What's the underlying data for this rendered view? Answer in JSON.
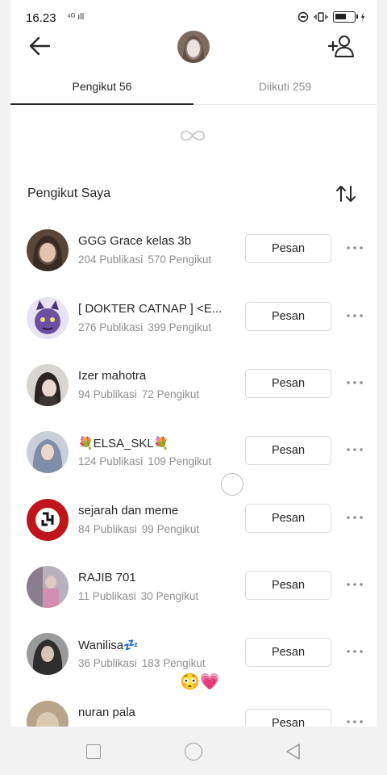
{
  "status_bar": {
    "time": "16.23",
    "signal": "⁴ᴳ ıll",
    "battery_level": 0.6
  },
  "header": {
    "back_icon": "arrow-left-icon",
    "avatar_icon": "profile-avatar",
    "add_icon": "add-person-icon"
  },
  "tabs": [
    {
      "label": "Pengikut 56",
      "active": true
    },
    {
      "label": "Diikuti 259",
      "active": false
    }
  ],
  "section": {
    "title": "Pengikut Saya",
    "sort_icon": "sort-arrows-icon"
  },
  "followers": [
    {
      "name": "GGG Grace kelas 3b",
      "posts": "204 Publikasi",
      "followers": "570 Pengikut",
      "button": "Pesan",
      "avatar_color": "#5a4636"
    },
    {
      "name": "[ DOKTER CATNAP ] <E...",
      "posts": "276 Publikasi",
      "followers": "399 Pengikut",
      "button": "Pesan",
      "avatar_color": "#6b4fa3"
    },
    {
      "name": "Izer mahotra",
      "posts": "94 Publikasi",
      "followers": "72 Pengikut",
      "button": "Pesan",
      "avatar_color": "#3a3532"
    },
    {
      "name": "💐ELSA_SKL💐",
      "posts": "124 Publikasi",
      "followers": "109 Pengikut",
      "button": "Pesan",
      "avatar_color": "#a9b2c2"
    },
    {
      "name": "sejarah dan meme",
      "posts": "84 Publikasi",
      "followers": "99 Pengikut",
      "button": "Pesan",
      "avatar_color": "#c0151a"
    },
    {
      "name": "RAJIB 701",
      "posts": "11 Publikasi",
      "followers": "30 Pengikut",
      "button": "Pesan",
      "avatar_color": "#7a5a7c"
    },
    {
      "name": "Wanilisa💤",
      "posts": "36 Publikasi",
      "followers": "183 Pengikut",
      "button": "Pesan",
      "avatar_color": "#4a4a4a"
    },
    {
      "name": "nuran pala",
      "posts": "",
      "followers": "",
      "button": "Pesan",
      "avatar_color": "#b7a48a"
    }
  ],
  "overlay": {
    "emojis": "😳💗"
  },
  "colors": {
    "text": "#262626",
    "muted": "#8e8e8e",
    "border": "#dbdbdb"
  }
}
